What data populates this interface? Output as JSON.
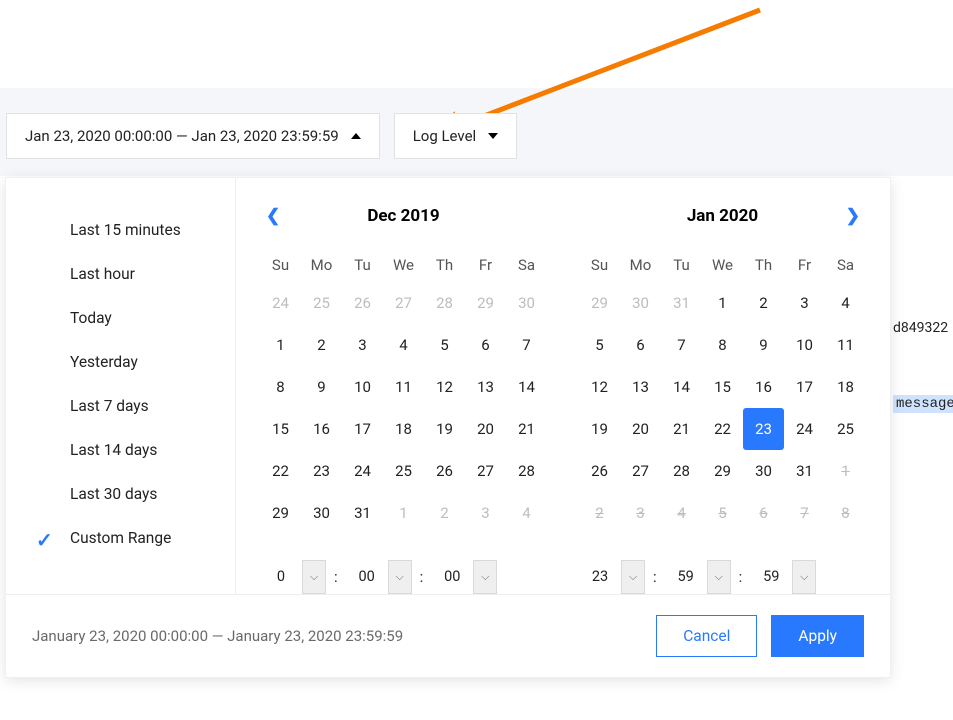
{
  "toolbar": {
    "range_label": "Jan 23, 2020 00:00:00 — Jan 23, 2020 23:59:59",
    "log_level_label": "Log Level"
  },
  "presets": [
    {
      "label": "Last 15 minutes",
      "selected": false
    },
    {
      "label": "Last hour",
      "selected": false
    },
    {
      "label": "Today",
      "selected": false
    },
    {
      "label": "Yesterday",
      "selected": false
    },
    {
      "label": "Last 7 days",
      "selected": false
    },
    {
      "label": "Last 14 days",
      "selected": false
    },
    {
      "label": "Last 30 days",
      "selected": false
    },
    {
      "label": "Custom Range",
      "selected": true
    }
  ],
  "calendar": {
    "weekdays": [
      "Su",
      "Mo",
      "Tu",
      "We",
      "Th",
      "Fr",
      "Sa"
    ],
    "left": {
      "title": "Dec 2019",
      "weeks": [
        [
          {
            "d": "24",
            "m": 1
          },
          {
            "d": "25",
            "m": 1
          },
          {
            "d": "26",
            "m": 1
          },
          {
            "d": "27",
            "m": 1
          },
          {
            "d": "28",
            "m": 1
          },
          {
            "d": "29",
            "m": 1
          },
          {
            "d": "30",
            "m": 1
          }
        ],
        [
          {
            "d": "1"
          },
          {
            "d": "2"
          },
          {
            "d": "3"
          },
          {
            "d": "4"
          },
          {
            "d": "5"
          },
          {
            "d": "6"
          },
          {
            "d": "7"
          }
        ],
        [
          {
            "d": "8"
          },
          {
            "d": "9"
          },
          {
            "d": "10"
          },
          {
            "d": "11"
          },
          {
            "d": "12"
          },
          {
            "d": "13"
          },
          {
            "d": "14"
          }
        ],
        [
          {
            "d": "15"
          },
          {
            "d": "16"
          },
          {
            "d": "17"
          },
          {
            "d": "18"
          },
          {
            "d": "19"
          },
          {
            "d": "20"
          },
          {
            "d": "21"
          }
        ],
        [
          {
            "d": "22"
          },
          {
            "d": "23"
          },
          {
            "d": "24"
          },
          {
            "d": "25"
          },
          {
            "d": "26"
          },
          {
            "d": "27"
          },
          {
            "d": "28"
          }
        ],
        [
          {
            "d": "29"
          },
          {
            "d": "30"
          },
          {
            "d": "31"
          },
          {
            "d": "1",
            "m": 1
          },
          {
            "d": "2",
            "m": 1
          },
          {
            "d": "3",
            "m": 1
          },
          {
            "d": "4",
            "m": 1
          }
        ]
      ]
    },
    "right": {
      "title": "Jan 2020",
      "weeks": [
        [
          {
            "d": "29",
            "m": 1
          },
          {
            "d": "30",
            "m": 1
          },
          {
            "d": "31",
            "m": 1
          },
          {
            "d": "1"
          },
          {
            "d": "2"
          },
          {
            "d": "3"
          },
          {
            "d": "4"
          }
        ],
        [
          {
            "d": "5"
          },
          {
            "d": "6"
          },
          {
            "d": "7"
          },
          {
            "d": "8"
          },
          {
            "d": "9"
          },
          {
            "d": "10"
          },
          {
            "d": "11"
          }
        ],
        [
          {
            "d": "12"
          },
          {
            "d": "13"
          },
          {
            "d": "14"
          },
          {
            "d": "15"
          },
          {
            "d": "16"
          },
          {
            "d": "17"
          },
          {
            "d": "18"
          }
        ],
        [
          {
            "d": "19"
          },
          {
            "d": "20"
          },
          {
            "d": "21"
          },
          {
            "d": "22"
          },
          {
            "d": "23",
            "sel": 1
          },
          {
            "d": "24"
          },
          {
            "d": "25"
          }
        ],
        [
          {
            "d": "26"
          },
          {
            "d": "27"
          },
          {
            "d": "28"
          },
          {
            "d": "29"
          },
          {
            "d": "30"
          },
          {
            "d": "31"
          },
          {
            "d": "1",
            "s": 1
          }
        ],
        [
          {
            "d": "2",
            "s": 1
          },
          {
            "d": "3",
            "s": 1
          },
          {
            "d": "4",
            "s": 1
          },
          {
            "d": "5",
            "s": 1
          },
          {
            "d": "6",
            "s": 1
          },
          {
            "d": "7",
            "s": 1
          },
          {
            "d": "8",
            "s": 1
          }
        ]
      ]
    }
  },
  "time": {
    "start": {
      "h": "0",
      "m": "00",
      "s": "00"
    },
    "end": {
      "h": "23",
      "m": "59",
      "s": "59"
    }
  },
  "footer": {
    "range_text": "January 23, 2020 00:00:00 — January 23, 2020 23:59:59",
    "cancel": "Cancel",
    "apply": "Apply"
  },
  "background": {
    "hash_fragment": "d849322",
    "message_label": "message"
  },
  "colors": {
    "accent": "#2979ff",
    "arrow": "#f57c00"
  }
}
